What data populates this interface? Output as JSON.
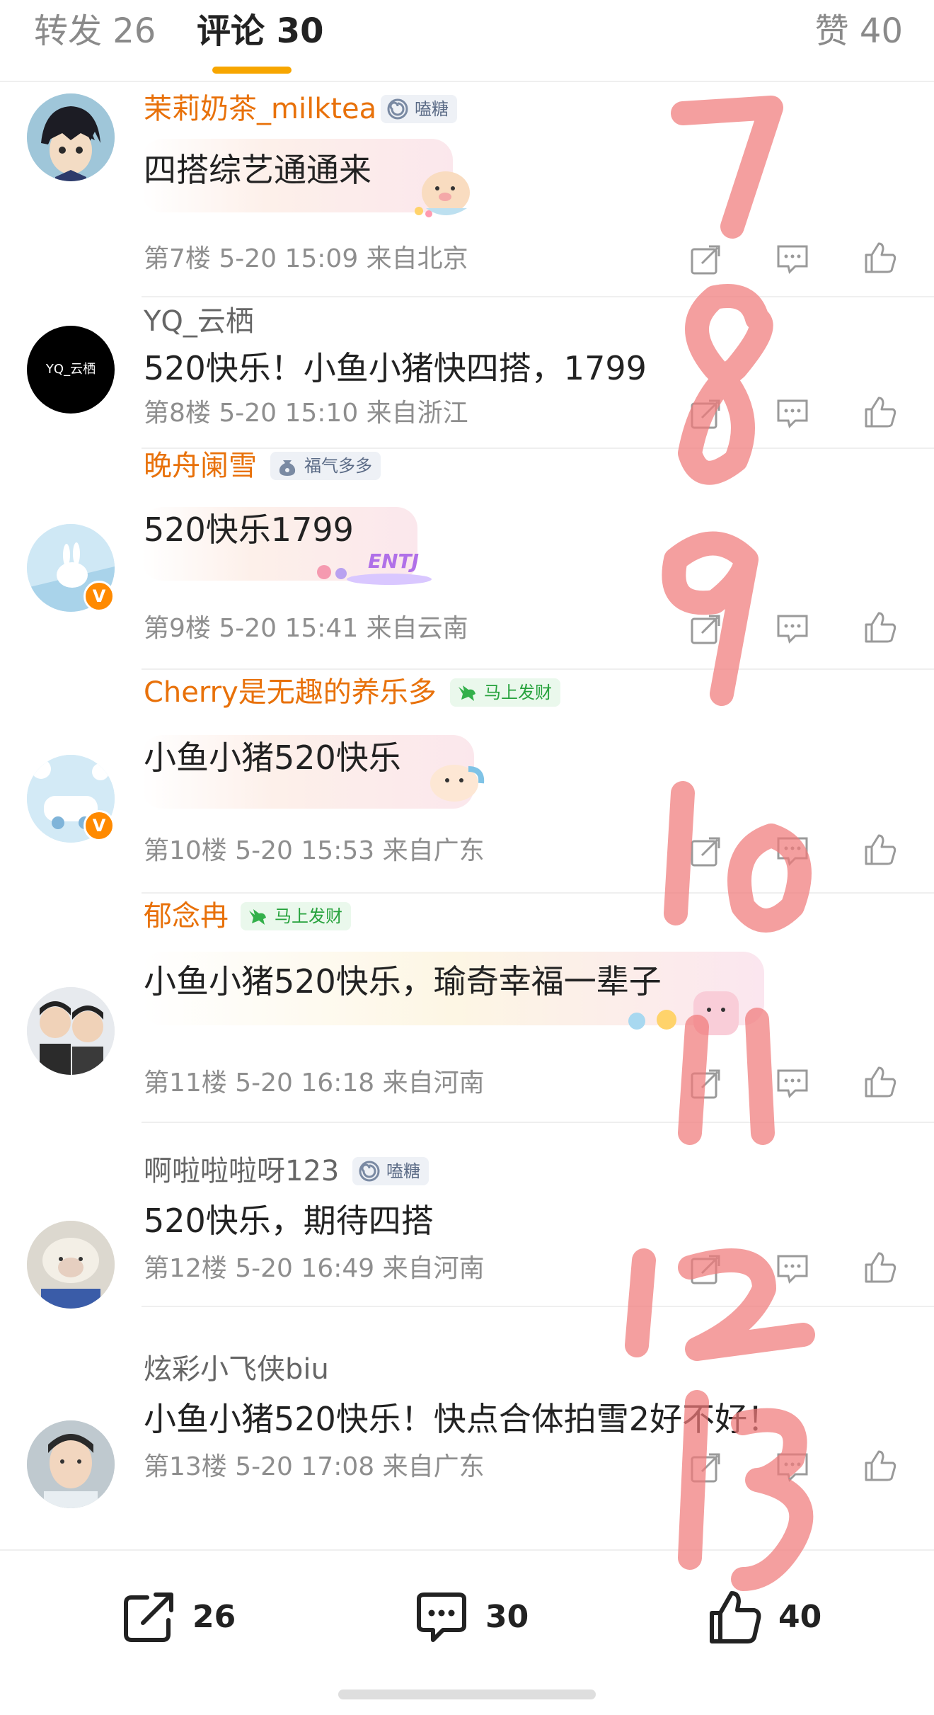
{
  "tabs": {
    "repost": "转发 26",
    "comment": "评论 30",
    "like": "赞 40"
  },
  "comments": [
    {
      "username": "茉莉奶茶_milktea",
      "medal": "嗑糖",
      "text": "四搭综艺通通来",
      "meta": "第7楼 5-20 15:09 来自北京"
    },
    {
      "username": "YQ_云栖",
      "avatar_text": "YQ_云栖",
      "text": "520快乐！小鱼小猪快四搭，1799",
      "meta": "第8楼 5-20 15:10 来自浙江"
    },
    {
      "username": "晚舟阑雪",
      "medal": "福气多多",
      "text": "520快乐1799",
      "meta": "第9楼 5-20 15:41 来自云南",
      "sticker_text": "ENTJ"
    },
    {
      "username": "Cherry是无趣的养乐多",
      "medal": "马上发财",
      "text": "小鱼小猪520快乐",
      "meta": "第10楼 5-20 15:53 来自广东"
    },
    {
      "username": "郁念冉",
      "medal": "马上发财",
      "text": "小鱼小猪520快乐，瑜奇幸福一辈子",
      "meta": "第11楼 5-20 16:18 来自河南"
    },
    {
      "username": "啊啦啦啦呀123",
      "medal": "嗑糖",
      "text": "520快乐，期待四搭",
      "meta": "第12楼 5-20 16:49 来自河南"
    },
    {
      "username": "炫彩小飞侠biu",
      "text": "小鱼小猪520快乐！快点合体拍雪2好不好！",
      "meta": "第13楼 5-20 17:08 来自广东"
    }
  ],
  "bottom_bar": {
    "share_count": "26",
    "comment_count": "30",
    "like_count": "40"
  },
  "overlay_numbers": [
    "7",
    "8",
    "9",
    "10",
    "11",
    "12",
    "13"
  ],
  "colors": {
    "accent": "#f7a600",
    "username_orange": "#e8710a",
    "overlay_red": "#f07a7a"
  }
}
